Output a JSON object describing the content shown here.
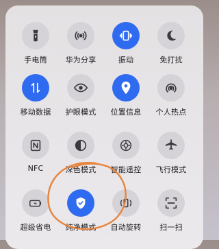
{
  "tiles": [
    {
      "id": "flashlight",
      "label": "手电筒",
      "active": false
    },
    {
      "id": "huawei-share",
      "label": "华为分享",
      "active": false
    },
    {
      "id": "vibrate",
      "label": "振动",
      "active": true
    },
    {
      "id": "do-not-disturb",
      "label": "免打扰",
      "active": false
    },
    {
      "id": "mobile-data",
      "label": "移动数据",
      "active": true
    },
    {
      "id": "eye-comfort",
      "label": "护眼模式",
      "active": false
    },
    {
      "id": "location",
      "label": "位置信息",
      "active": true
    },
    {
      "id": "hotspot",
      "label": "个人热点",
      "active": false
    },
    {
      "id": "nfc",
      "label": "NFC",
      "active": false
    },
    {
      "id": "dark-mode",
      "label": "深色模式",
      "active": false
    },
    {
      "id": "smart-remote",
      "label": "智能遥控",
      "active": false
    },
    {
      "id": "airplane-mode",
      "label": "飞行模式",
      "active": false
    },
    {
      "id": "super-power-saving",
      "label": "超级省电",
      "active": false
    },
    {
      "id": "pure-mode",
      "label": "纯净模式",
      "active": true
    },
    {
      "id": "auto-rotate",
      "label": "自动旋转",
      "active": false
    },
    {
      "id": "scan",
      "label": "扫一扫",
      "active": false
    }
  ],
  "colors": {
    "active": "#2f6bf1",
    "inactive": "#d5d3d8",
    "icon_dark": "#3a3a3e",
    "annotation": "#e8833a"
  }
}
